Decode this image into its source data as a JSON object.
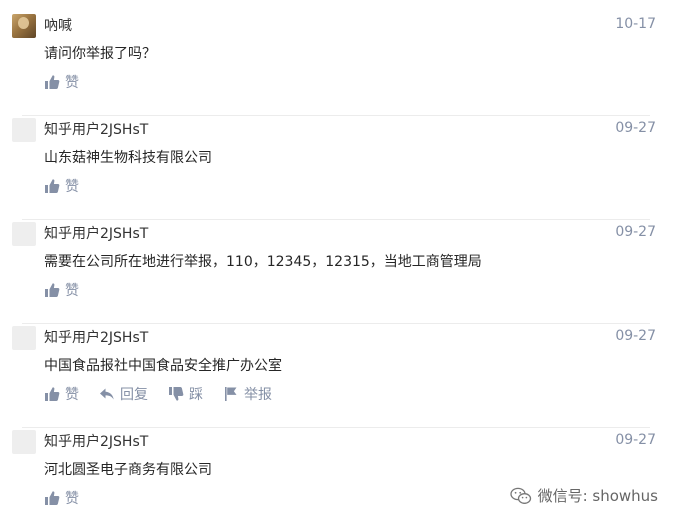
{
  "comments": [
    {
      "author": "吶喊",
      "date": "10-17",
      "text": "请问你举报了吗？",
      "avatar": "photo",
      "actions": {
        "like": "赞"
      }
    },
    {
      "author": "知乎用户2JSHsT",
      "date": "09-27",
      "text": "山东菇神生物科技有限公司",
      "avatar": "default",
      "actions": {
        "like": "赞"
      }
    },
    {
      "author": "知乎用户2JSHsT",
      "date": "09-27",
      "text": "需要在公司所在地进行举报，110，12345，12315，当地工商管理局",
      "avatar": "default",
      "actions": {
        "like": "赞"
      }
    },
    {
      "author": "知乎用户2JSHsT",
      "date": "09-27",
      "text": "中国食品报社中国食品安全推广办公室",
      "avatar": "default",
      "actions": {
        "like": "赞",
        "reply": "回复",
        "dislike": "踩",
        "report": "举报"
      }
    },
    {
      "author": "知乎用户2JSHsT",
      "date": "09-27",
      "text": "河北圆圣电子商务有限公司",
      "avatar": "default",
      "actions": {
        "like": "赞"
      }
    }
  ],
  "watermark": {
    "text": "微信号: showhus"
  },
  "colors": {
    "meta": "#8590a6",
    "text": "#262626",
    "author": "#333333",
    "divider": "#ececec"
  },
  "icons": {
    "like": "thumbs-up-icon",
    "reply": "reply-arrow-icon",
    "dislike": "thumbs-down-icon",
    "report": "flag-icon",
    "watermark": "wechat-icon"
  }
}
